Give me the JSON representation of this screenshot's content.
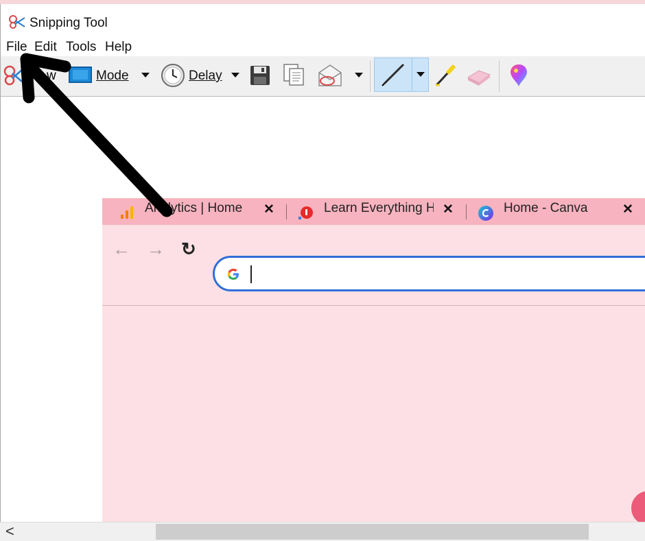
{
  "window": {
    "title": "Snipping Tool",
    "icon": "scissors-icon"
  },
  "menu": [
    {
      "label": "File"
    },
    {
      "label": "Edit"
    },
    {
      "label": "Tools"
    },
    {
      "label": "Help"
    }
  ],
  "toolbar": {
    "new_label": "w",
    "mode_label": "Mode",
    "delay_label": "Delay",
    "icons": [
      "new-snip-icon",
      "mode-icon",
      "clock-icon",
      "save-icon",
      "copy-icon",
      "send-email-icon",
      "pen-icon",
      "highlighter-icon",
      "eraser-icon",
      "paint3d-icon"
    ]
  },
  "browser": {
    "tabs": [
      {
        "title": "Analytics | Home",
        "icon": "analytics-icon"
      },
      {
        "title": "Learn Everything He",
        "icon": "red-drop-icon"
      },
      {
        "title": "Home - Canva",
        "icon": "canva-icon"
      }
    ],
    "tab_close": "✕",
    "back": "←",
    "forward": "→",
    "reload": "↻",
    "address_value": ""
  },
  "scrollbar": {
    "left_arrow": "<"
  },
  "colors": {
    "tabstrip": "#f7b3bf",
    "page_bg": "#fde0e5",
    "omnibox_border": "#2f6ed8",
    "pen_group": "#cce4f7"
  }
}
